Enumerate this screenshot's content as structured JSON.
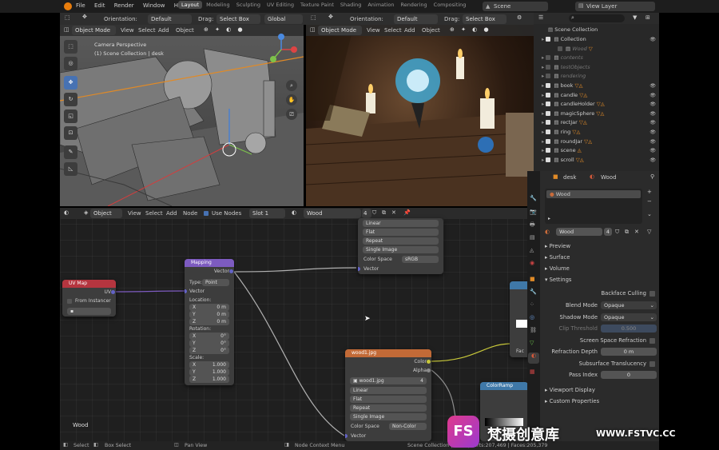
{
  "topbar": {
    "menus": [
      "File",
      "Edit",
      "Render",
      "Window",
      "Help"
    ],
    "workspaces": [
      "Layout",
      "Modeling",
      "Sculpting",
      "UV Editing",
      "Texture Paint",
      "Shading",
      "Animation",
      "Rendering",
      "Compositing"
    ],
    "active_workspace": "Layout",
    "scene": "Scene",
    "view_layer": "View Layer"
  },
  "toolbar": {
    "orientation_label": "Orientation:",
    "orientation_value": "Default",
    "drag_label": "Drag:",
    "drag_value": "Select Box",
    "transform_value": "Global"
  },
  "viewport_left": {
    "mode": "Object Mode",
    "menus": [
      "View",
      "Select",
      "Add",
      "Object"
    ],
    "info_line1": "Camera Perspective",
    "info_line2": "(1) Scene Collection | desk"
  },
  "viewport_right": {
    "mode": "Object Mode",
    "menus": [
      "View",
      "Select",
      "Add",
      "Object"
    ]
  },
  "node_editor": {
    "mode": "Object",
    "menus": [
      "View",
      "Select",
      "Add",
      "Node"
    ],
    "use_nodes": "Use Nodes",
    "slot": "Slot 1",
    "material": "Wood",
    "users": "4",
    "footer_label": "Wood",
    "top_node": {
      "rows": [
        "Linear",
        "Flat",
        "Repeat",
        "Single Image"
      ],
      "color_space_label": "Color Space",
      "color_space_value": "sRGB",
      "vector": "Vector"
    },
    "uvmap": {
      "title": "UV Map",
      "uv": "UV",
      "from_instancer": "From Instancer"
    },
    "mapping": {
      "title": "Mapping",
      "vector_out": "Vector",
      "type_label": "Type:",
      "type_value": "Point",
      "vector_in": "Vector",
      "location": "Location:",
      "loc": [
        "0 m",
        "0 m",
        "0 m"
      ],
      "rotation": "Rotation:",
      "rot": [
        "0°",
        "0°",
        "0°"
      ],
      "scale": "Scale:",
      "scl": [
        "1.000",
        "1.000",
        "1.000"
      ],
      "axes": [
        "X",
        "Y",
        "Z"
      ]
    },
    "wood_image": {
      "title": "wood1.jpg",
      "color": "Color",
      "alpha": "Alpha",
      "file": "wood1.jpg",
      "users": "4",
      "rows": [
        "Linear",
        "Flat",
        "Repeat",
        "Single Image"
      ],
      "color_space_label": "Color Space",
      "color_space_value": "Non-Color",
      "vector": "Vector"
    },
    "colorramp": {
      "title": "ColorRamp"
    },
    "right_node": {
      "fac": "Fac"
    }
  },
  "outliner": {
    "root": "Scene Collection",
    "items": [
      {
        "name": "Collection",
        "level": 1
      },
      {
        "name": "Wood",
        "level": 2,
        "dim": true
      },
      {
        "name": "contents",
        "level": 1,
        "dim": true
      },
      {
        "name": "testObjects",
        "level": 1,
        "dim": true
      },
      {
        "name": "rendering",
        "level": 1,
        "dim": true
      },
      {
        "name": "book",
        "level": 1
      },
      {
        "name": "candle",
        "level": 1
      },
      {
        "name": "candleHolder",
        "level": 1
      },
      {
        "name": "magicSphere",
        "level": 1
      },
      {
        "name": "rectJar",
        "level": 1
      },
      {
        "name": "ring",
        "level": 1
      },
      {
        "name": "roundJar",
        "level": 1
      },
      {
        "name": "scene",
        "level": 1
      },
      {
        "name": "scroll",
        "level": 1
      }
    ]
  },
  "properties": {
    "object": "desk",
    "material": "Wood",
    "slot_material": "Wood",
    "datablock": "Wood",
    "users": "4",
    "panels": [
      "Preview",
      "Surface",
      "Volume"
    ],
    "settings": "Settings",
    "backface_culling": "Backface Culling",
    "blend_mode_label": "Blend Mode",
    "blend_mode": "Opaque",
    "shadow_mode_label": "Shadow Mode",
    "shadow_mode": "Opaque",
    "clip_threshold_label": "Clip Threshold",
    "clip_threshold": "0.500",
    "ssr": "Screen Space Refraction",
    "refraction_depth_label": "Refraction Depth",
    "refraction_depth": "0 m",
    "subsurface": "Subsurface Translucency",
    "pass_index_label": "Pass Index",
    "pass_index": "0",
    "bottom_panels": [
      "Viewport Display",
      "Custom Properties"
    ]
  },
  "statusbar": {
    "select": "Select",
    "box_select": "Box Select",
    "pan_view": "Pan View",
    "node_context": "Node Context Menu",
    "stats": "Scene Collection | desk | Verts:207,469 | Faces:205,379"
  },
  "watermark": {
    "logo": "FS",
    "cn": "梵摄创意库",
    "url": "WWW.FSTVC.CC"
  },
  "colors": {
    "accent": "#4772b3",
    "node_orange": "#c26a37",
    "node_purple": "#7d5bc0",
    "node_red": "#b5353f",
    "node_blue": "#3f78a8"
  }
}
